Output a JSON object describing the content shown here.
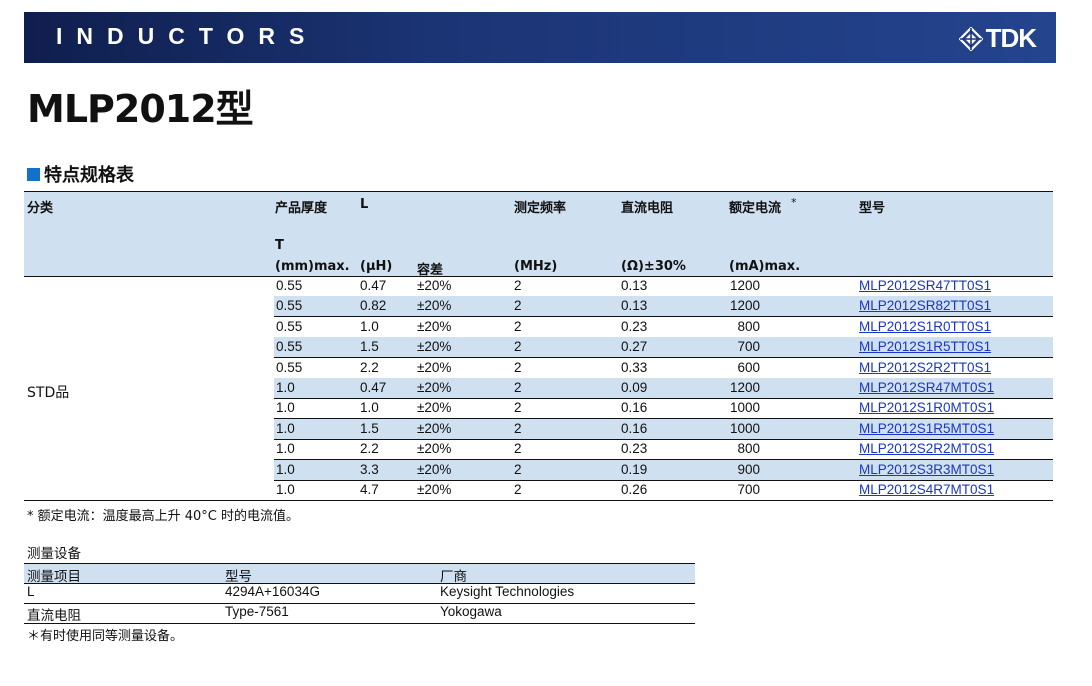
{
  "banner": {
    "title": "INDUCTORS",
    "brand": "TDK",
    "brand_icon": "tdk-diamond-logo"
  },
  "page_title": "MLP2012型",
  "section_title": "特点规格表",
  "spec_table": {
    "headers": {
      "category": "分类",
      "thickness_1": "产品厚度",
      "thickness_2": "T",
      "thickness_3": "(mm)max.",
      "l_1": "L",
      "l_2": "(μH)",
      "tolerance": "容差",
      "freq_1": "测定频率",
      "freq_2": "(MHz)",
      "dcr_1": "直流电阻",
      "dcr_2": "(Ω)±30%",
      "current_1": "额定电流",
      "current_star": "*",
      "current_2": "(mA)max.",
      "part_no": "型号"
    },
    "category_value": "STD品",
    "rows": [
      [
        "0.55",
        "0.47",
        "±20%",
        "2",
        "0.13",
        "1200",
        "MLP2012SR47TT0S1"
      ],
      [
        "0.55",
        "0.82",
        "±20%",
        "2",
        "0.13",
        "1200",
        "MLP2012SR82TT0S1"
      ],
      [
        "0.55",
        "1.0",
        "±20%",
        "2",
        "0.23",
        "800",
        "MLP2012S1R0TT0S1"
      ],
      [
        "0.55",
        "1.5",
        "±20%",
        "2",
        "0.27",
        "700",
        "MLP2012S1R5TT0S1"
      ],
      [
        "0.55",
        "2.2",
        "±20%",
        "2",
        "0.33",
        "600",
        "MLP2012S2R2TT0S1"
      ],
      [
        "1.0",
        "0.47",
        "±20%",
        "2",
        "0.09",
        "1200",
        "MLP2012SR47MT0S1"
      ],
      [
        "1.0",
        "1.0",
        "±20%",
        "2",
        "0.16",
        "1000",
        "MLP2012S1R0MT0S1"
      ],
      [
        "1.0",
        "1.5",
        "±20%",
        "2",
        "0.16",
        "1000",
        "MLP2012S1R5MT0S1"
      ],
      [
        "1.0",
        "2.2",
        "±20%",
        "2",
        "0.23",
        "800",
        "MLP2012S2R2MT0S1"
      ],
      [
        "1.0",
        "3.3",
        "±20%",
        "2",
        "0.19",
        "900",
        "MLP2012S3R3MT0S1"
      ],
      [
        "1.0",
        "4.7",
        "±20%",
        "2",
        "0.26",
        "700",
        "MLP2012S4R7MT0S1"
      ]
    ]
  },
  "footnote": "* 额定电流：温度最高上升 40°C 时的电流值。",
  "equipment": {
    "title": "测量设备",
    "headers": {
      "item": "测量项目",
      "model": "型号",
      "maker": "厂商"
    },
    "rows": [
      [
        "L",
        "4294A+16034G",
        "Keysight Technologies"
      ],
      [
        "直流电阻",
        "Type-7561",
        "Yokogawa"
      ]
    ],
    "note": "＊有时使用同等测量设备。"
  },
  "colors": {
    "banner": "#1b3474",
    "header_fill": "#cfe0f1",
    "link": "#1a35c8",
    "accent_square": "#1272c8"
  }
}
